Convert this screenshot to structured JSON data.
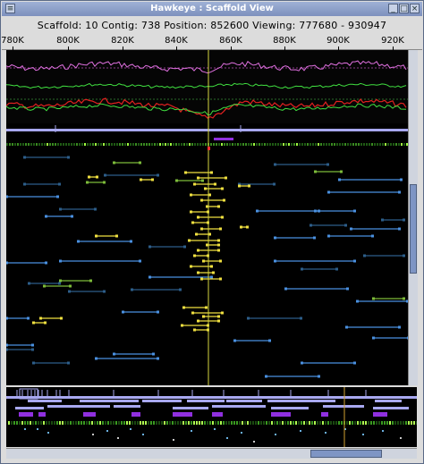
{
  "window": {
    "title": "Hawkeye : Scaffold View",
    "menu_icon": "window-menu-icon",
    "minimize_icon": "minimize-icon",
    "maximize_icon": "maximize-icon",
    "close_icon": "close-icon"
  },
  "info": {
    "text": "Scaffold: 10  Contig: 738  Position: 852600  Viewing: 777680 - 930947"
  },
  "ruler": {
    "ticks": [
      "780K",
      "800K",
      "820K",
      "840K",
      "860K",
      "880K",
      "900K",
      "920K"
    ]
  },
  "colors": {
    "background": "#000000",
    "cursor_line": "#d6d640",
    "coverage_magenta": "#e070e0",
    "coverage_green": "#40e040",
    "coverage_red": "#e02020",
    "read_blue": "#4a90e0",
    "read_yellow": "#f0e040",
    "overview_lavender": "#a8a8f0",
    "overview_purple": "#9030e0"
  }
}
